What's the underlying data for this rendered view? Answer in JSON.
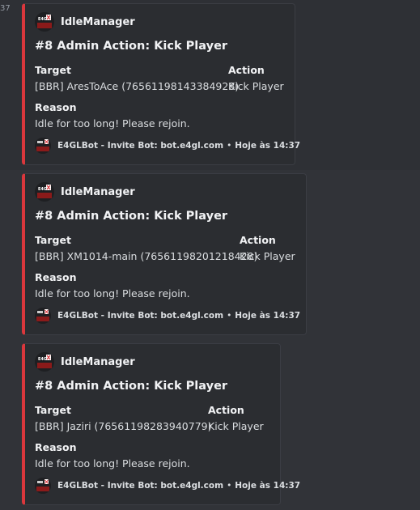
{
  "first_timestamp": "37",
  "accent_color": "#da373c",
  "messages": [
    {
      "author": "IdleManager",
      "title": "#8 Admin Action: Kick Player",
      "target_label": "Target",
      "target_value": "[BBR] AresToAce (76561198143384928)",
      "action_label": "Action",
      "action_value": "Kick Player",
      "reason_label": "Reason",
      "reason_value": "Idle for too long! Please rejoin.",
      "footer_text": "E4GLBot - Invite Bot: bot.e4gl.com",
      "footer_separator": "•",
      "footer_time": "Hoje às 14:37"
    },
    {
      "author": "IdleManager",
      "title": "#8 Admin Action: Kick Player",
      "target_label": "Target",
      "target_value": "[BBR] XM1014-main (76561198201218428)",
      "action_label": "Action",
      "action_value": "Kick Player",
      "reason_label": "Reason",
      "reason_value": "Idle for too long! Please rejoin.",
      "footer_text": "E4GLBot - Invite Bot: bot.e4gl.com",
      "footer_separator": "•",
      "footer_time": "Hoje às 14:37"
    },
    {
      "author": "IdleManager",
      "title": "#8 Admin Action: Kick Player",
      "target_label": "Target",
      "target_value": "[BBR] Jaziri (76561198283940779)",
      "action_label": "Action",
      "action_value": "Kick Player",
      "reason_label": "Reason",
      "reason_value": "Idle for too long! Please rejoin.",
      "footer_text": "E4GLBot - Invite Bot: bot.e4gl.com",
      "footer_separator": "•",
      "footer_time": "Hoje às 14:37"
    }
  ]
}
